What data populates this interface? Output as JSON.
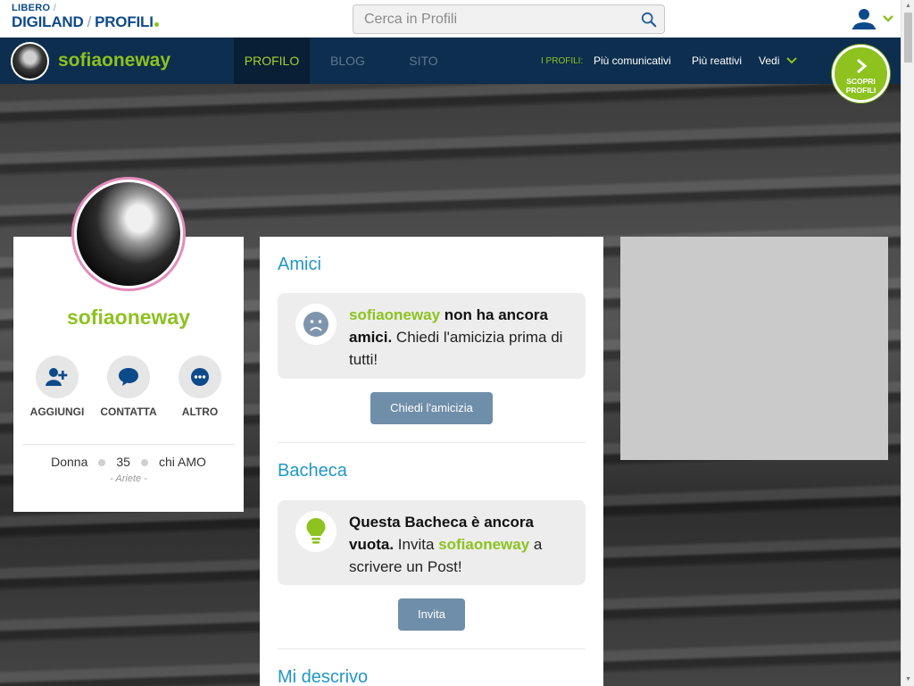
{
  "header": {
    "logo_line1": "LIBERO",
    "logo_line2_a": "DIGILAND",
    "logo_line2_b": "PROFILI",
    "logo_slash": "/",
    "search_placeholder": "Cerca in Profili"
  },
  "nav": {
    "username": "sofiaoneway",
    "tabs": [
      {
        "label": "PROFILO",
        "active": true
      },
      {
        "label": "BLOG",
        "active": false
      },
      {
        "label": "SITO",
        "active": false
      }
    ],
    "profiles_label": "I PROFILI:",
    "links": [
      "Più comunicativi",
      "Più reattivi",
      "Vedi"
    ],
    "discover_line1": "SCOPRI",
    "discover_line2": "PROFILI"
  },
  "profile": {
    "name": "sofiaoneway",
    "actions": [
      {
        "label": "AGGIUNGI",
        "icon": "add-user-icon"
      },
      {
        "label": "CONTATTA",
        "icon": "chat-icon"
      },
      {
        "label": "ALTRO",
        "icon": "more-icon"
      }
    ],
    "gender": "Donna",
    "age": "35",
    "looking_for": "chi AMO",
    "sign": "- Ariete -"
  },
  "friends": {
    "title": "Amici",
    "name": "sofiaoneway",
    "bold_text": " non ha ancora amici.",
    "rest_text": " Chiedi l'amicizia prima di tutti!",
    "button": "Chiedi l'amicizia"
  },
  "wall": {
    "title": "Bacheca",
    "bold_text": "Questa Bacheca è ancora vuota.",
    "text_before": " Invita ",
    "name": "sofiaoneway",
    "text_after": " a scrivere un Post!",
    "button": "Invita"
  },
  "describe": {
    "title": "Mi descrivo"
  },
  "colors": {
    "accent_green": "#8dc21f",
    "nav_dark": "#0d2e4e",
    "link_blue": "#2196c8",
    "avatar_ring": "#e48bbb"
  }
}
